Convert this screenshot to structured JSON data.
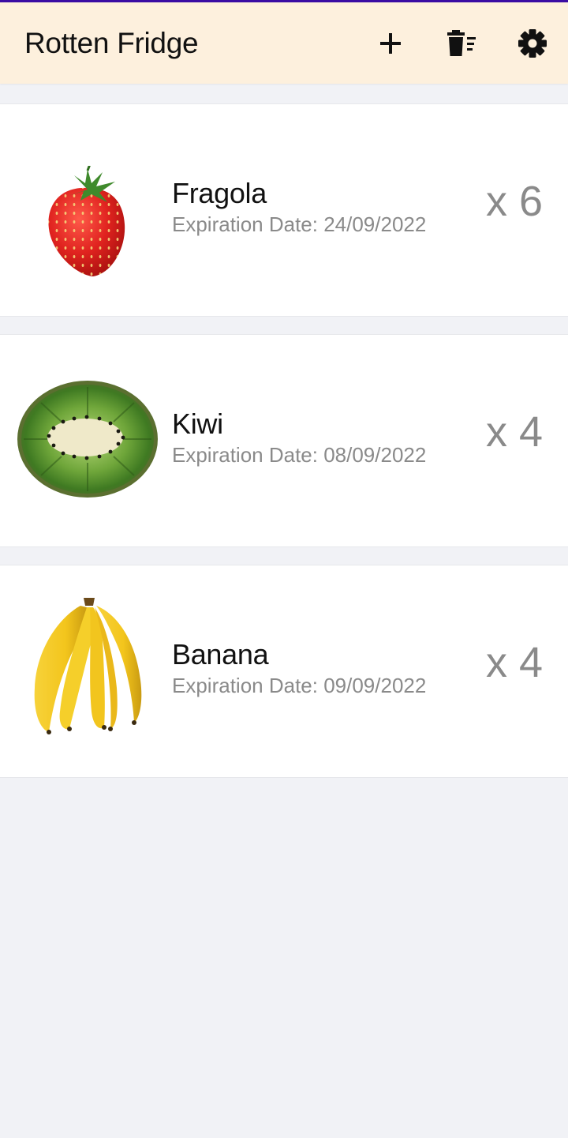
{
  "app": {
    "title": "Rotten Fridge",
    "actions": [
      {
        "icon": "plus-icon"
      },
      {
        "icon": "trash-clear-icon"
      },
      {
        "icon": "gear-icon"
      }
    ]
  },
  "items": [
    {
      "name": "Fragola",
      "expiration": "Expiration Date: 24/09/2022",
      "quantity": "x 6",
      "image": "strawberry-image"
    },
    {
      "name": "Kiwi",
      "expiration": "Expiration Date: 08/09/2022",
      "quantity": "x 4",
      "image": "kiwi-image"
    },
    {
      "name": "Banana",
      "expiration": "Expiration Date: 09/09/2022",
      "quantity": "x 4",
      "image": "banana-image"
    }
  ],
  "colors": {
    "appbar": "#fdf0dd",
    "background": "#f1f2f6",
    "card": "#ffffff",
    "muted_text": "#8a8a8a",
    "status_line": "#3a0ca3"
  }
}
